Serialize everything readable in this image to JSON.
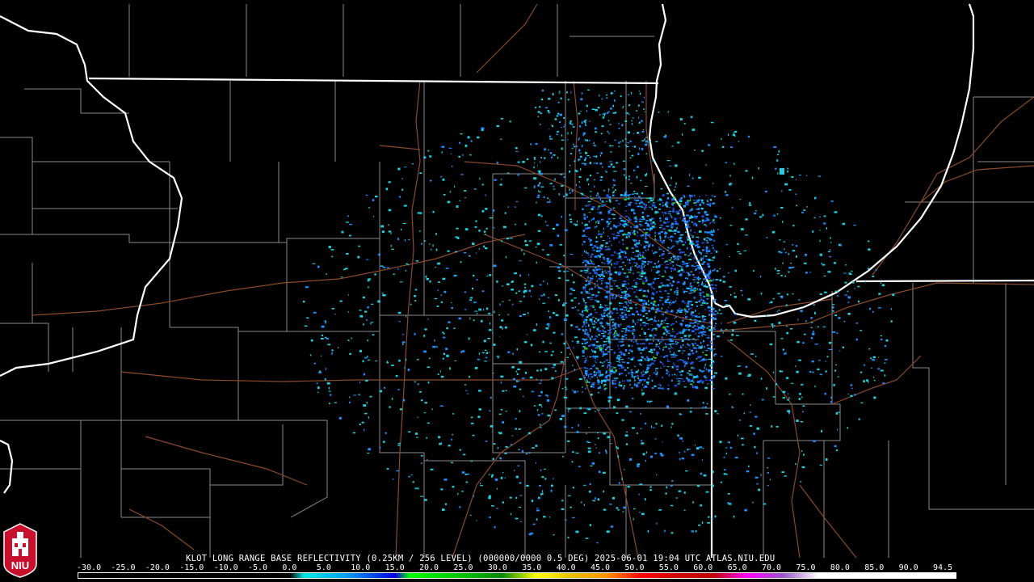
{
  "product": {
    "caption": "KLOT LONG RANGE BASE REFLECTIVITY (0.25KM / 256 LEVEL) (000000/0000 0.5 DEG) 2025-06-01 19:04 UTC  ATLAS.NIU.EDU"
  },
  "legend": {
    "labels": [
      "-30.0",
      "-25.0",
      "-20.0",
      "-15.0",
      "-10.0",
      "-5.0",
      "0.0",
      "5.0",
      "10.0",
      "15.0",
      "20.0",
      "25.0",
      "30.0",
      "35.0",
      "40.0",
      "45.0",
      "50.0",
      "55.0",
      "60.0",
      "65.0",
      "70.0",
      "75.0",
      "80.0",
      "85.0",
      "90.0",
      "94.5"
    ],
    "color_stops": [
      {
        "dbz": -30,
        "color": "#000000"
      },
      {
        "dbz": 0,
        "color": "#000000"
      },
      {
        "dbz": 2,
        "color": "#00e8e8"
      },
      {
        "dbz": 8,
        "color": "#00a0f0"
      },
      {
        "dbz": 15,
        "color": "#0000e0"
      },
      {
        "dbz": 17,
        "color": "#00ff00"
      },
      {
        "dbz": 25,
        "color": "#00c000"
      },
      {
        "dbz": 30,
        "color": "#008800"
      },
      {
        "dbz": 35,
        "color": "#ffff00"
      },
      {
        "dbz": 40,
        "color": "#e8c000"
      },
      {
        "dbz": 45,
        "color": "#ff9000"
      },
      {
        "dbz": 50,
        "color": "#ff0000"
      },
      {
        "dbz": 55,
        "color": "#d00000"
      },
      {
        "dbz": 60,
        "color": "#c00000"
      },
      {
        "dbz": 65,
        "color": "#ff00ff"
      },
      {
        "dbz": 70,
        "color": "#9955c9"
      },
      {
        "dbz": 75,
        "color": "#ffffff"
      },
      {
        "dbz": 94.5,
        "color": "#ffffff"
      }
    ]
  },
  "logo": {
    "text": "NIU",
    "color": "#c8102e"
  },
  "colors": {
    "background": "#000000",
    "state_border": "#ffffff",
    "county_border": "#8a8a8a",
    "highway": "#8b4a2b",
    "radar_light": "#1ed0e0",
    "radar_mid": "#1e90ff",
    "radar_dark": "#2050e0",
    "radar_green": "#30c030"
  }
}
